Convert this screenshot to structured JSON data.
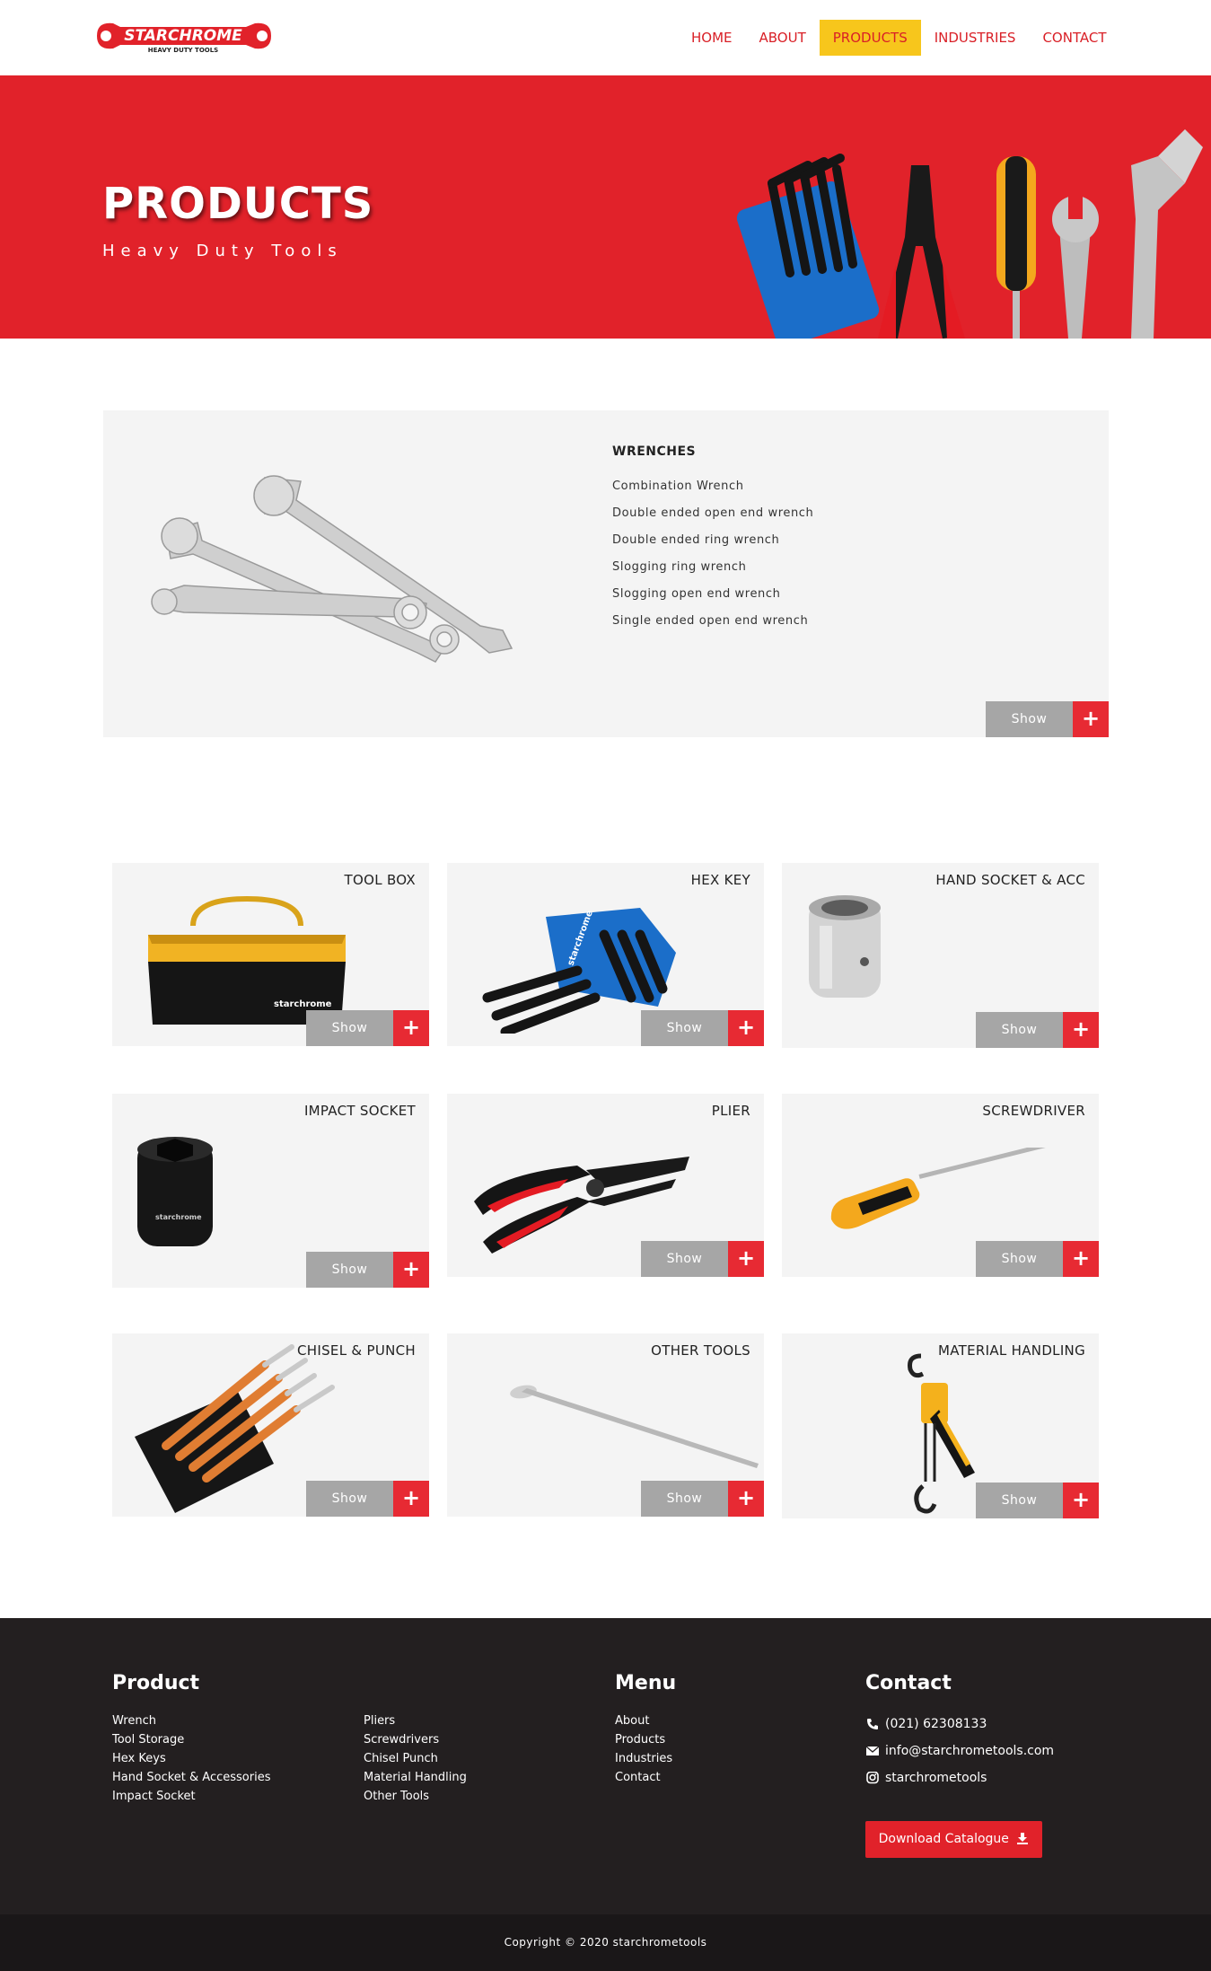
{
  "brand": {
    "logo_text": "STARCHROME",
    "logo_tagline": "HEAVY DUTY TOOLS",
    "primary_color": "#e1222a",
    "accent_color": "#f7c61c",
    "dark_color": "#231f20"
  },
  "nav": {
    "items": [
      {
        "label": "HOME"
      },
      {
        "label": "ABOUT"
      },
      {
        "label": "PRODUCTS",
        "active": true
      },
      {
        "label": "INDUSTRIES"
      },
      {
        "label": "CONTACT"
      }
    ]
  },
  "hero": {
    "title": "PRODUCTS",
    "subtitle": "Heavy Duty Tools"
  },
  "featured": {
    "title": "WRENCHES",
    "items": [
      "Combination Wrench",
      "Double ended open end wrench",
      "Double ended ring wrench",
      "Slogging ring wrench",
      "Slogging open end wrench",
      "Single ended open end wrench"
    ],
    "show_label": "Show",
    "plus_label": "+"
  },
  "grid": {
    "show_label": "Show",
    "plus_label": "+",
    "cards": [
      {
        "title": "TOOL BOX",
        "icon": "toolbox-image"
      },
      {
        "title": "HEX KEY",
        "icon": "hex-key-image"
      },
      {
        "title": "HAND SOCKET & ACC",
        "icon": "hand-socket-image"
      },
      {
        "title": "IMPACT SOCKET",
        "icon": "impact-socket-image"
      },
      {
        "title": "PLIER",
        "icon": "plier-image"
      },
      {
        "title": "SCREWDRIVER",
        "icon": "screwdriver-image"
      },
      {
        "title": "CHISEL & PUNCH",
        "icon": "chisel-punch-image"
      },
      {
        "title": "OTHER TOOLS",
        "icon": "other-tools-image"
      },
      {
        "title": "MATERIAL HANDLING",
        "icon": "material-handling-image"
      }
    ]
  },
  "footer": {
    "product_heading": "Product",
    "product_col1": [
      "Wrench",
      "Tool Storage",
      "Hex Keys",
      "Hand Socket & Accessories",
      "Impact Socket"
    ],
    "product_col2": [
      "Pliers",
      "Screwdrivers",
      "Chisel Punch",
      "Material Handling",
      "Other Tools"
    ],
    "menu_heading": "Menu",
    "menu_items": [
      "About",
      "Products",
      "Industries",
      "Contact"
    ],
    "contact_heading": "Contact",
    "phone": "(021) 62308133",
    "email": "info@starchrometools.com",
    "instagram": "starchrometools",
    "download_label": "Download Catalogue",
    "copyright": "Copyright © 2020 starchrometools"
  }
}
